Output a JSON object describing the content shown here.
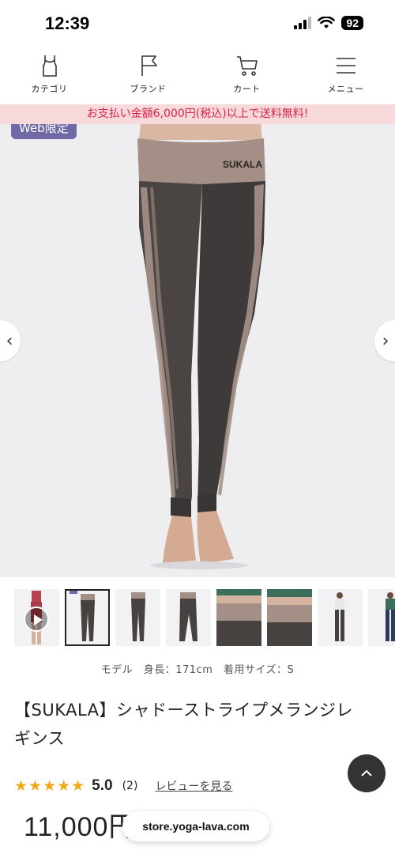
{
  "status_bar": {
    "time": "12:39",
    "battery": "92"
  },
  "nav": {
    "items": [
      {
        "label": "カテゴリ",
        "icon": "tank-top-icon"
      },
      {
        "label": "ブランド",
        "icon": "flag-icon"
      },
      {
        "label": "カート",
        "icon": "cart-icon"
      },
      {
        "label": "メニュー",
        "icon": "hamburger-menu-icon"
      }
    ]
  },
  "promo_banner": "お支払い金額6,000円(税込)以上で送料無料!",
  "hero": {
    "badge": "Web限定",
    "brand_print": "SUKALA",
    "prev_arrow": "‹",
    "next_arrow": "›"
  },
  "thumbnails": {
    "count": 9,
    "selected_index": 1
  },
  "model_info": "モデル　身長：171cm　着用サイズ：S",
  "product": {
    "title": "【SUKALA】シャドーストライプメランジレギンス",
    "stars": "★★★★★",
    "rating": "5.0",
    "review_count": "(2)",
    "review_link": "レビューを見る",
    "price": "11,000円"
  },
  "url_bar": "store.yoga-lava.com",
  "colors": {
    "promo_bg": "#f7d9db",
    "promo_text": "#d8254a",
    "badge": "#6f6aa6",
    "star": "#f0a81a"
  }
}
